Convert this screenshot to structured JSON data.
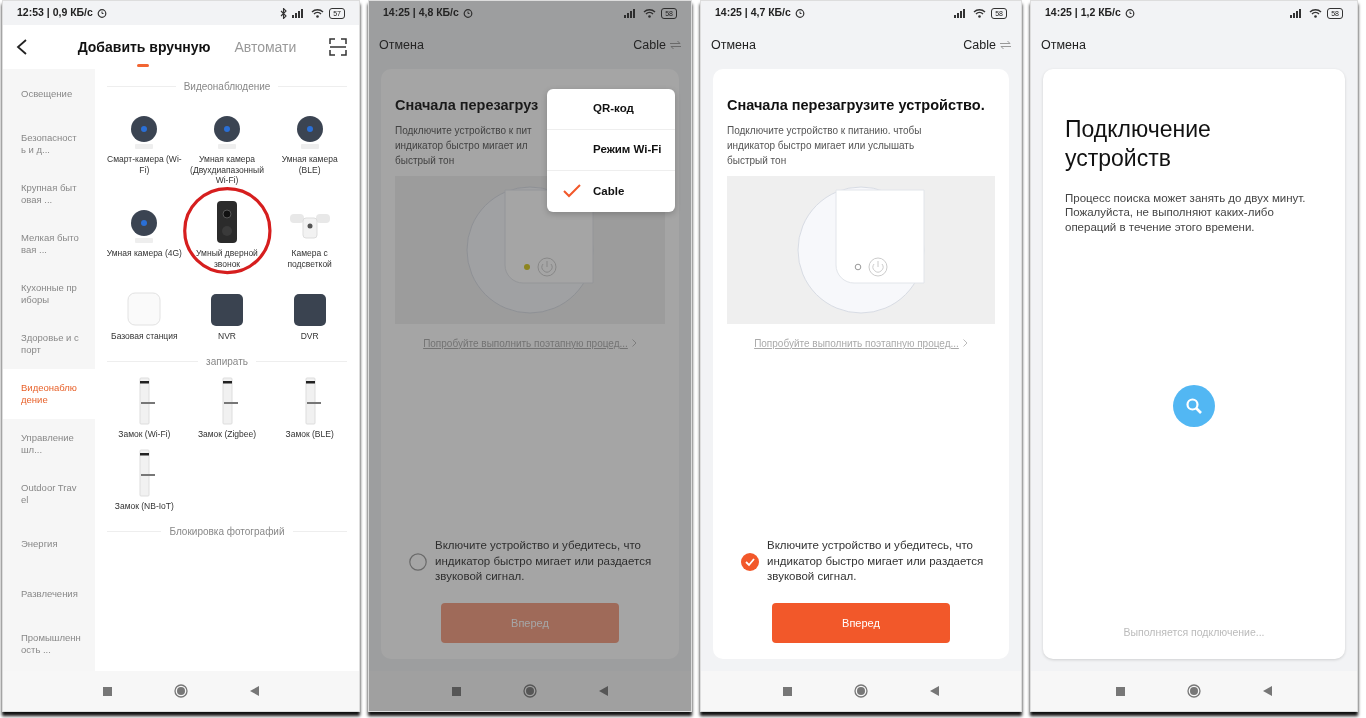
{
  "screens": [
    {
      "kind": "catalog",
      "status": {
        "time": "12:53 | 0,9 КБ/с",
        "bluetooth": true,
        "battery": "57"
      },
      "tabs": [
        {
          "label": "Добавить вручную",
          "selected": true
        },
        {
          "label": "Автомати",
          "selected": false
        }
      ],
      "sidebar": [
        {
          "label": "Освещение",
          "selected": false
        },
        {
          "label": "Безопасность и д...",
          "selected": false
        },
        {
          "label": "Крупная бытовая ...",
          "selected": false
        },
        {
          "label": "Мелкая бытовая ...",
          "selected": false
        },
        {
          "label": "Кухонные приборы",
          "selected": false
        },
        {
          "label": "Здоровье и спорт",
          "selected": false
        },
        {
          "label": "Видеонаблюдение",
          "selected": true
        },
        {
          "label": "Управление шл...",
          "selected": false
        },
        {
          "label": "Outdoor Travel",
          "selected": false
        },
        {
          "label": "Энергия",
          "selected": false
        },
        {
          "label": "Развлечения",
          "selected": false
        },
        {
          "label": "Промышленность ...",
          "selected": false
        }
      ],
      "sections": [
        {
          "title": "Видеонаблюдение",
          "items": [
            {
              "label": "Смарт-камера (Wi-Fi)",
              "kind": "camera",
              "circled": false
            },
            {
              "label": "Умная камера (Двухдиапазонный Wi-Fi)",
              "kind": "camera",
              "circled": false
            },
            {
              "label": "Умная камера (BLE)",
              "kind": "camera",
              "circled": false
            },
            {
              "label": "Умная камера (4G)",
              "kind": "camera",
              "circled": false
            },
            {
              "label": "Умный дверной звонок",
              "kind": "doorbell",
              "circled": true
            },
            {
              "label": "Камера с подсветкой",
              "kind": "floodlight",
              "circled": false
            },
            {
              "label": "Базовая станция",
              "kind": "hub",
              "circled": false
            },
            {
              "label": "NVR",
              "kind": "recorder",
              "circled": false
            },
            {
              "label": "DVR",
              "kind": "recorder",
              "circled": false
            }
          ]
        },
        {
          "title": "запирать",
          "items": [
            {
              "label": "Замок (Wi-Fi)",
              "kind": "lock",
              "circled": false
            },
            {
              "label": "Замок (Zigbee)",
              "kind": "lock",
              "circled": false
            },
            {
              "label": "Замок (BLE)",
              "kind": "lock",
              "circled": false
            },
            {
              "label": "Замок (NB-IoT)",
              "kind": "lock",
              "circled": false
            }
          ]
        },
        {
          "title": "Блокировка фотографий"
        }
      ]
    },
    {
      "kind": "setup",
      "dimmed": true,
      "status": {
        "time": "14:25 | 4,8 КБ/с",
        "battery": "58"
      },
      "cancel": "Отмена",
      "mode": "Cable",
      "title": "Сначала перезагруз",
      "description": "Подключите устройство к пит\nиндикатор быстро мигает ил\nбыстрый тон",
      "indicator_on": true,
      "link": "Попробуйте выполнить поэтапную процед...",
      "confirm": {
        "label": "Включите устройство и убедитесь, что индикатор быстро мигает или раздается звуковой сигнал.",
        "checked": false
      },
      "button": {
        "label": "Вперед",
        "disabled": true
      },
      "menu": [
        {
          "label": "QR-код",
          "selected": false
        },
        {
          "label": "Режим Wi-Fi",
          "selected": false
        },
        {
          "label": "Cable",
          "selected": true
        }
      ]
    },
    {
      "kind": "setup",
      "status": {
        "time": "14:25 | 4,7 КБ/с",
        "battery": "58"
      },
      "cancel": "Отмена",
      "mode": "Cable",
      "title": "Сначала перезагрузите устройство.",
      "description": "Подключите устройство к питанию. чтобы\nиндикатор быстро мигает или услышать\nбыстрый тон",
      "indicator_on": false,
      "link": "Попробуйте выполнить поэтапную процед...",
      "confirm": {
        "label": "Включите устройство и убедитесь, что индикатор быстро мигает или раздается звуковой сигнал.",
        "checked": true
      },
      "button": {
        "label": "Вперед",
        "disabled": false
      }
    },
    {
      "kind": "connecting",
      "status": {
        "time": "14:25 | 1,2 КБ/с",
        "battery": "58"
      },
      "cancel": "Отмена",
      "title": "Подключение устройств",
      "description": "Процесс поиска может занять до двух минут. Пожалуйста, не выполняют каких-либо операций в течение этого времени.",
      "progress": "Выполняется подключение..."
    }
  ]
}
